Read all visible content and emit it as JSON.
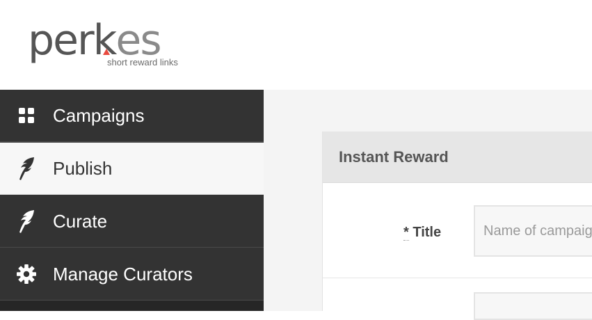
{
  "brand": {
    "name_part1": "per",
    "name_k": "k",
    "name_part2": "es",
    "tagline": "short reward links",
    "accent_color": "#e84a3f"
  },
  "sidebar": {
    "items": [
      {
        "label": "Campaigns",
        "icon": "grid-icon",
        "active": false
      },
      {
        "label": "Publish",
        "icon": "feather-icon",
        "active": true
      },
      {
        "label": "Curate",
        "icon": "feather-icon",
        "active": false
      },
      {
        "label": "Manage Curators",
        "icon": "gear-icon",
        "active": false
      }
    ]
  },
  "panel": {
    "title": "Instant Reward",
    "fields": {
      "title": {
        "required_marker": "*",
        "label": "Title",
        "placeholder": "Name of campaign"
      }
    }
  }
}
